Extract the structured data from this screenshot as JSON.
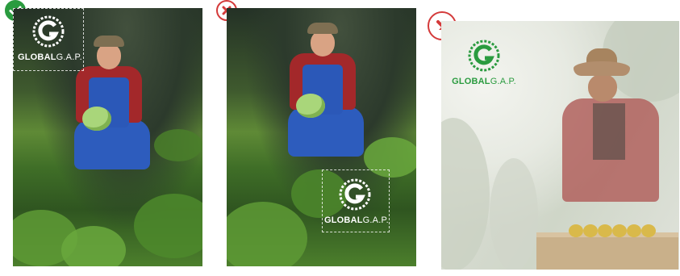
{
  "panels": [
    {
      "id": "correct-placement",
      "logo": {
        "brand": "GLOBAL",
        "suffix": "G.A.P.",
        "variant": "white"
      },
      "status_icon": "checkmark-icon",
      "status_color": "#2a9b3f"
    },
    {
      "id": "incorrect-placement",
      "logo": {
        "brand": "GLOBAL",
        "suffix": "G.A.P.",
        "variant": "white"
      },
      "status_icon": "cross-icon",
      "status_color": "#d43a3a"
    },
    {
      "id": "faded-photo-example",
      "logo": {
        "brand": "GLOBAL",
        "suffix": "G.A.P.",
        "variant": "green"
      },
      "status_icon": "arrow-down-right-icon",
      "status_color": "#d43a3a"
    }
  ],
  "colors": {
    "brand_green": "#2a9b3f",
    "warning_red": "#d43a3a"
  }
}
